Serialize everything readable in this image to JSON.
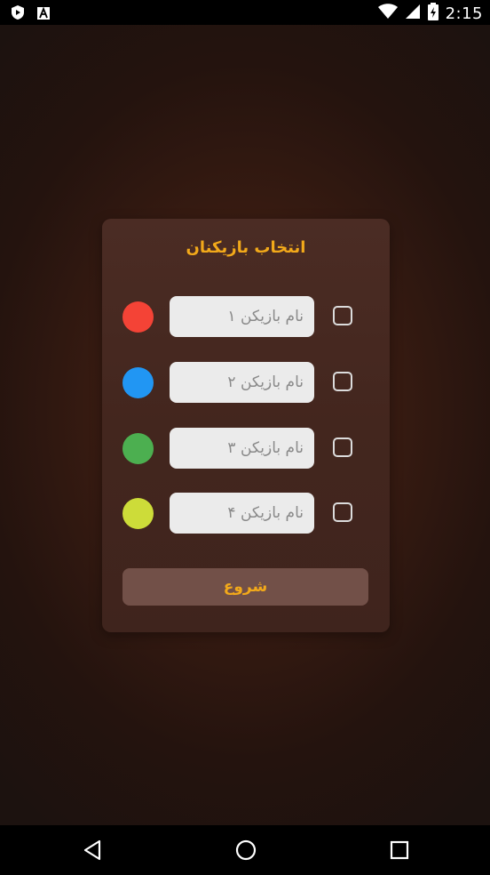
{
  "status_bar": {
    "time": "2:15",
    "left_icons": [
      "shield-app-icon",
      "font-app-icon"
    ],
    "right_icons": [
      "wifi-icon",
      "signal-icon",
      "battery-icon"
    ]
  },
  "dialog": {
    "title": "انتخاب بازیکنان",
    "players": [
      {
        "placeholder": "نام بازیکن ۱",
        "value": "",
        "color": "#f44336",
        "checked": false
      },
      {
        "placeholder": "نام بازیکن ۲",
        "value": "",
        "color": "#2196f3",
        "checked": false
      },
      {
        "placeholder": "نام بازیکن ۳",
        "value": "",
        "color": "#4caf50",
        "checked": false
      },
      {
        "placeholder": "نام بازیکن ۴",
        "value": "",
        "color": "#cddc39",
        "checked": false
      }
    ],
    "start_label": "شروع",
    "accent_color": "#f2a91a"
  },
  "nav_bar": {
    "buttons": [
      "back-icon",
      "home-icon",
      "recents-icon"
    ]
  }
}
